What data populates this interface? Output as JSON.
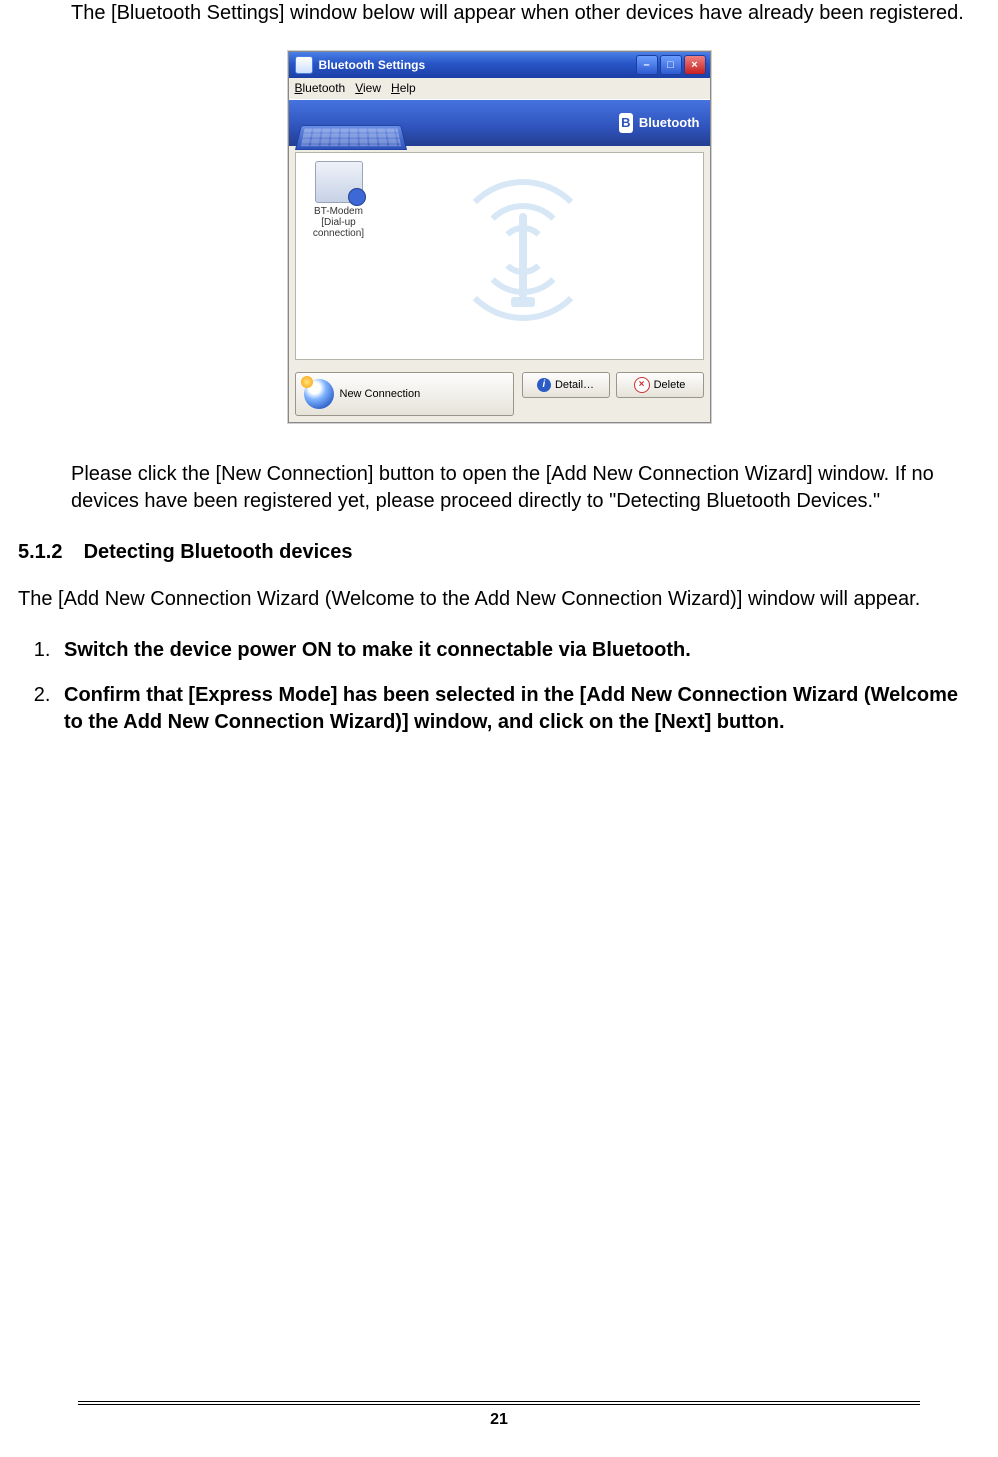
{
  "intro_para": "The [Bluetooth Settings] window below will appear when other devices have already been registered.",
  "followup_para": "Please click the [New Connection] button to open the [Add New Connection Wizard] window. If no devices have been registered yet, please proceed directly to \"Detecting Bluetooth Devices.\"",
  "section": {
    "number": "5.1.2",
    "title": "Detecting Bluetooth devices"
  },
  "section_para": "The [Add New Connection Wizard (Welcome to the Add New Connection Wizard)] window will appear.",
  "steps": [
    "Switch the device power ON to make it connectable via Bluetooth.",
    "Confirm that [Express Mode] has been selected in the [Add New Connection Wizard (Welcome to the Add New Connection Wizard)] window, and click on the [Next] button."
  ],
  "page_number": "21",
  "window": {
    "title": "Bluetooth Settings",
    "menu": {
      "bluetooth": "Bluetooth",
      "view": "View",
      "help": "Help"
    },
    "banner_label": "Bluetooth",
    "device_label": "BT-Modem [Dial-up connection]",
    "new_connection_label": "New Connection",
    "detail_label": "Detail…",
    "delete_label": "Delete",
    "min_glyph": "–",
    "max_glyph": "□",
    "close_glyph": "×"
  }
}
